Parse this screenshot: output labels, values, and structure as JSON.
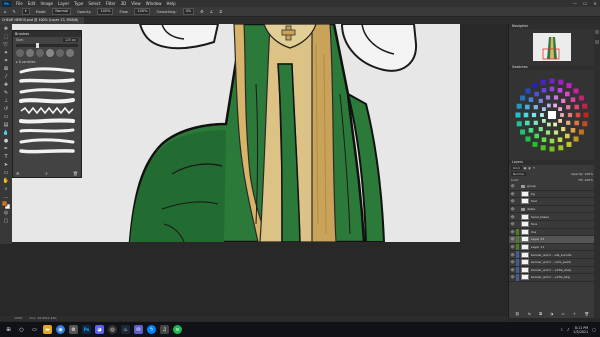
{
  "app": {
    "logo": "Ps",
    "menu": [
      "File",
      "Edit",
      "Image",
      "Layer",
      "Type",
      "Select",
      "Filter",
      "3D",
      "View",
      "Window",
      "Help"
    ],
    "window_controls": [
      "—",
      "☐",
      "✕"
    ]
  },
  "options_bar": {
    "mode_label": "Mode:",
    "mode_value": "Normal",
    "opacity_label": "Opacity:",
    "opacity_value": "100%",
    "flow_label": "Flow:",
    "flow_value": "100%",
    "smoothing_label": "Smoothing:",
    "smoothing_value": "0%"
  },
  "document_tab": {
    "label": "CHEAR HEROS.psd @ 100% (Layer 13, RGB/8)"
  },
  "brushes_panel": {
    "title": "Brushes",
    "size_label": "Size:",
    "size_value": "125 px",
    "folder_label": "▸ 8 varieties",
    "search_placeholder": "Search"
  },
  "right_panels": {
    "navigator_title": "Navigator",
    "swatches_title": "Swatches",
    "layers_title": "Layers",
    "kind_label": "Kind",
    "blend_mode": "Normal",
    "opacity": "Opacity: 100%",
    "fill": "Fill: 100%",
    "lock": "Lock:"
  },
  "layers": [
    {
      "name": "group",
      "type": "group",
      "visible": true,
      "color": ""
    },
    {
      "name": "bg",
      "type": "layer",
      "visible": true,
      "color": ""
    },
    {
      "name": "hed",
      "type": "layer",
      "visible": true,
      "color": ""
    },
    {
      "name": "detail",
      "type": "group",
      "visible": true,
      "color": ""
    },
    {
      "name": "hand_shaen",
      "type": "layer",
      "visible": true,
      "color": ""
    },
    {
      "name": "face",
      "type": "layer",
      "visible": true,
      "color": ""
    },
    {
      "name": "line",
      "type": "layer",
      "visible": true,
      "color": "#4c7a2e"
    },
    {
      "name": "Layer 13",
      "type": "layer",
      "visible": true,
      "color": "#4c7a2e",
      "selected": true
    },
    {
      "name": "Layer 11",
      "type": "layer",
      "visible": true,
      "color": "#4c7a2e"
    },
    {
      "name": "banner_arm1 ...ide_burnhe",
      "type": "layer",
      "visible": true,
      "color": "#3e5f94"
    },
    {
      "name": "banner_arm1 ...ocks_paint",
      "type": "layer",
      "visible": true,
      "color": "#3e5f94"
    },
    {
      "name": "banner_arm1 ...uirtle_shop",
      "type": "layer",
      "visible": true,
      "color": "#3e5f94"
    },
    {
      "name": "banner_arm1 ...uirtle_bkg",
      "type": "layer",
      "visible": true,
      "color": "#3e5f94"
    }
  ],
  "status_bar": {
    "zoom": "100%",
    "doc": "Doc: 26.0M/1.44G"
  },
  "taskbar": {
    "time": "8:11 PM",
    "date": "2/5/2021",
    "icons": [
      "windows-start-icon",
      "search-icon",
      "task-view-icon",
      "explorer-icon",
      "chrome-icon",
      "settings-icon",
      "photoshop-icon",
      "discord-icon",
      "obs-icon",
      "steam-icon",
      "chat-icon",
      "messenger-icon",
      "headset-icon",
      "spotify-icon"
    ]
  },
  "colors": {
    "robe_green": "#2c7a3a",
    "robe_dark": "#1f5a2a",
    "hair_gold": "#d8b36a",
    "gold_trim": "#c9a35a",
    "canvas_bg": "#e6e6e6"
  }
}
